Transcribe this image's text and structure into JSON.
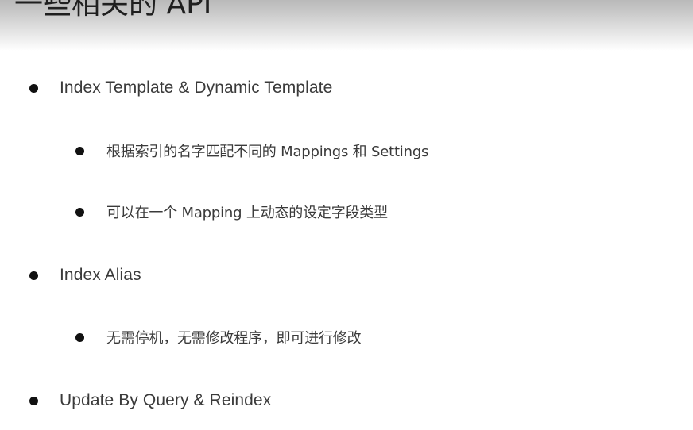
{
  "slide": {
    "title": "一些相关的 API",
    "bullets": [
      {
        "text": "Index Template & Dynamic Template",
        "sub": [
          "根据索引的名字匹配不同的 Mappings 和 Settings",
          "可以在一个 Mapping 上动态的设定字段类型"
        ]
      },
      {
        "text": "Index Alias",
        "sub": [
          "无需停机，无需修改程序，即可进行修改"
        ]
      },
      {
        "text": "Update By Query & Reindex",
        "sub": []
      }
    ]
  }
}
